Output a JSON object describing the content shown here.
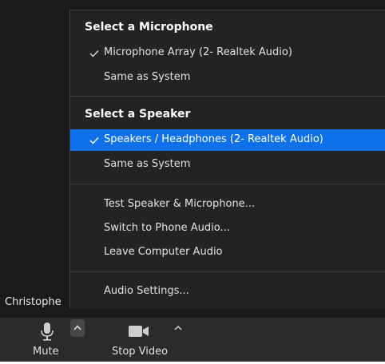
{
  "menu": {
    "microphone_header": "Select a Microphone",
    "microphone_items": [
      {
        "label": "Microphone Array (2- Realtek Audio)",
        "checked": true
      },
      {
        "label": "Same as System",
        "checked": false
      }
    ],
    "speaker_header": "Select a Speaker",
    "speaker_items": [
      {
        "label": "Speakers / Headphones (2- Realtek Audio)",
        "checked": true
      },
      {
        "label": "Same as System",
        "checked": false
      }
    ],
    "actions": [
      {
        "label": "Test Speaker & Microphone..."
      },
      {
        "label": "Switch to Phone Audio..."
      },
      {
        "label": "Leave Computer Audio"
      }
    ],
    "settings": {
      "label": "Audio Settings..."
    }
  },
  "participant": {
    "name": "Christophe"
  },
  "toolbar": {
    "mute_label": "Mute",
    "video_label": "Stop Video"
  },
  "colors": {
    "menu_bg": "#232323",
    "highlight": "#0e71eb",
    "toolbar_bg": "#2b2b2b"
  }
}
